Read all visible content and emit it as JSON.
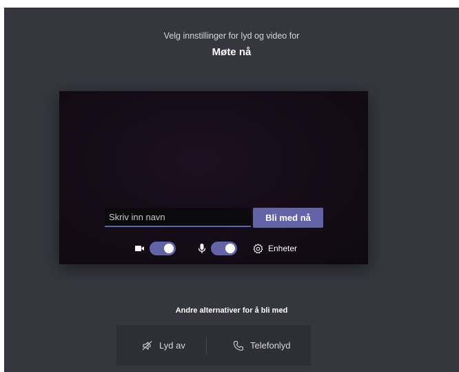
{
  "header": {
    "subtitle": "Velg innstillinger for lyd og video for",
    "meeting_title": "Møte nå"
  },
  "join": {
    "name_placeholder": "Skriv inn navn",
    "name_value": "",
    "join_label": "Bli med nå"
  },
  "controls": {
    "camera": {
      "icon": "video-camera-icon",
      "on": true
    },
    "microphone": {
      "icon": "microphone-icon",
      "on": true
    },
    "devices_label": "Enheter",
    "devices_icon": "gear-icon"
  },
  "other_options": {
    "title": "Andre alternativer for å bli med",
    "audio_off_label": "Lyd av",
    "audio_off_icon": "speaker-off-icon",
    "phone_audio_label": "Telefonlyd",
    "phone_audio_icon": "phone-icon"
  },
  "colors": {
    "background": "#36363f",
    "accent": "#6264a7",
    "options_panel": "#2e2e36"
  }
}
